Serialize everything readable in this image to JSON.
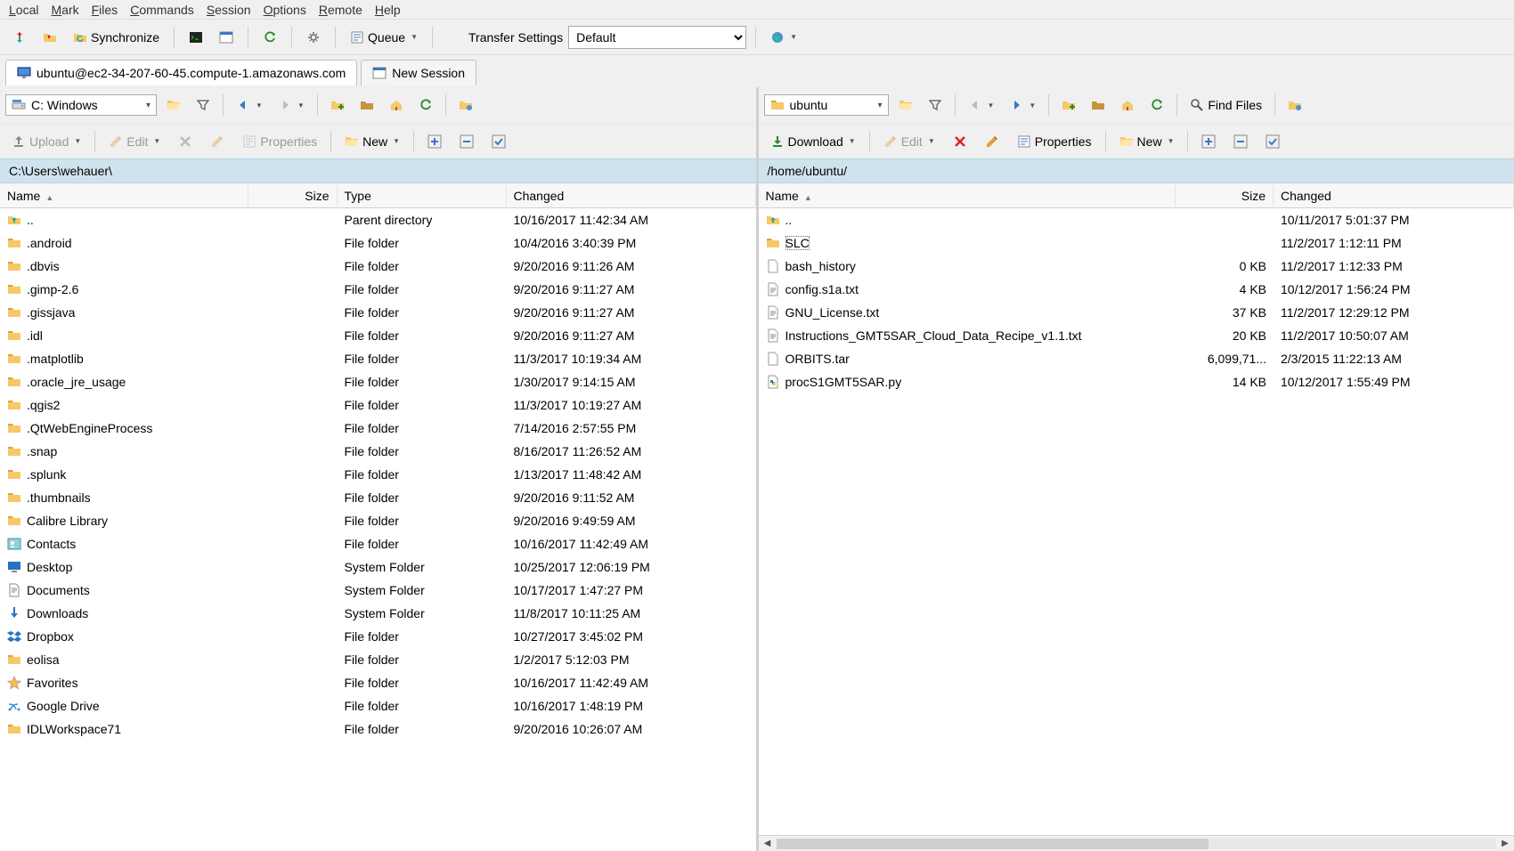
{
  "menu": [
    "Local",
    "Mark",
    "Files",
    "Commands",
    "Session",
    "Options",
    "Remote",
    "Help"
  ],
  "toolbar": {
    "sync_label": "Synchronize",
    "queue_label": "Queue",
    "transfer_label": "Transfer Settings",
    "transfer_value": "Default"
  },
  "session_tab": "ubuntu@ec2-34-207-60-45.compute-1.amazonaws.com",
  "new_session": "New Session",
  "left": {
    "drive": "C: Windows",
    "upload": "Upload",
    "edit": "Edit",
    "properties": "Properties",
    "new": "New",
    "path": "C:\\Users\\wehauer\\",
    "headers": {
      "name": "Name",
      "size": "Size",
      "type": "Type",
      "changed": "Changed"
    },
    "rows": [
      {
        "name": "..",
        "type": "Parent directory",
        "changed": "10/16/2017  11:42:34 AM",
        "icon": "up"
      },
      {
        "name": ".android",
        "type": "File folder",
        "changed": "10/4/2016  3:40:39 PM",
        "icon": "folder"
      },
      {
        "name": ".dbvis",
        "type": "File folder",
        "changed": "9/20/2016  9:11:26 AM",
        "icon": "folder"
      },
      {
        "name": ".gimp-2.6",
        "type": "File folder",
        "changed": "9/20/2016  9:11:27 AM",
        "icon": "folder"
      },
      {
        "name": ".gissjava",
        "type": "File folder",
        "changed": "9/20/2016  9:11:27 AM",
        "icon": "folder"
      },
      {
        "name": ".idl",
        "type": "File folder",
        "changed": "9/20/2016  9:11:27 AM",
        "icon": "folder"
      },
      {
        "name": ".matplotlib",
        "type": "File folder",
        "changed": "11/3/2017  10:19:34 AM",
        "icon": "folder"
      },
      {
        "name": ".oracle_jre_usage",
        "type": "File folder",
        "changed": "1/30/2017  9:14:15 AM",
        "icon": "folder"
      },
      {
        "name": ".qgis2",
        "type": "File folder",
        "changed": "11/3/2017  10:19:27 AM",
        "icon": "folder"
      },
      {
        "name": ".QtWebEngineProcess",
        "type": "File folder",
        "changed": "7/14/2016  2:57:55 PM",
        "icon": "folder"
      },
      {
        "name": ".snap",
        "type": "File folder",
        "changed": "8/16/2017  11:26:52 AM",
        "icon": "folder"
      },
      {
        "name": ".splunk",
        "type": "File folder",
        "changed": "1/13/2017  11:48:42 AM",
        "icon": "folder"
      },
      {
        "name": ".thumbnails",
        "type": "File folder",
        "changed": "9/20/2016  9:11:52 AM",
        "icon": "folder"
      },
      {
        "name": "Calibre Library",
        "type": "File folder",
        "changed": "9/20/2016  9:49:59 AM",
        "icon": "folder"
      },
      {
        "name": "Contacts",
        "type": "File folder",
        "changed": "10/16/2017  11:42:49 AM",
        "icon": "contacts"
      },
      {
        "name": "Desktop",
        "type": "System Folder",
        "changed": "10/25/2017  12:06:19 PM",
        "icon": "desktop"
      },
      {
        "name": "Documents",
        "type": "System Folder",
        "changed": "10/17/2017  1:47:27 PM",
        "icon": "documents"
      },
      {
        "name": "Downloads",
        "type": "System Folder",
        "changed": "11/8/2017  10:11:25 AM",
        "icon": "downloads"
      },
      {
        "name": "Dropbox",
        "type": "File folder",
        "changed": "10/27/2017  3:45:02 PM",
        "icon": "dropbox"
      },
      {
        "name": "eolisa",
        "type": "File folder",
        "changed": "1/2/2017  5:12:03 PM",
        "icon": "folder"
      },
      {
        "name": "Favorites",
        "type": "File folder",
        "changed": "10/16/2017  11:42:49 AM",
        "icon": "star"
      },
      {
        "name": "Google Drive",
        "type": "File folder",
        "changed": "10/16/2017  1:48:19 PM",
        "icon": "gdrive"
      },
      {
        "name": "IDLWorkspace71",
        "type": "File folder",
        "changed": "9/20/2016  10:26:07 AM",
        "icon": "folder"
      }
    ]
  },
  "right": {
    "drive": "ubuntu",
    "download": "Download",
    "edit": "Edit",
    "properties": "Properties",
    "new": "New",
    "find": "Find Files",
    "path": "/home/ubuntu/",
    "headers": {
      "name": "Name",
      "size": "Size",
      "changed": "Changed"
    },
    "rows": [
      {
        "name": "..",
        "size": "",
        "changed": "10/11/2017 5:01:37 PM",
        "icon": "up"
      },
      {
        "name": "SLC",
        "size": "",
        "changed": "11/2/2017 1:12:11 PM",
        "icon": "folder",
        "selected": true
      },
      {
        "name": "bash_history",
        "size": "0 KB",
        "changed": "11/2/2017 1:12:33 PM",
        "icon": "file"
      },
      {
        "name": "config.s1a.txt",
        "size": "4 KB",
        "changed": "10/12/2017 1:56:24 PM",
        "icon": "txt"
      },
      {
        "name": "GNU_License.txt",
        "size": "37 KB",
        "changed": "11/2/2017 12:29:12 PM",
        "icon": "txt"
      },
      {
        "name": "Instructions_GMT5SAR_Cloud_Data_Recipe_v1.1.txt",
        "size": "20 KB",
        "changed": "11/2/2017 10:50:07 AM",
        "icon": "txt"
      },
      {
        "name": "ORBITS.tar",
        "size": "6,099,71...",
        "changed": "2/3/2015 11:22:13 AM",
        "icon": "file"
      },
      {
        "name": "procS1GMT5SAR.py",
        "size": "14 KB",
        "changed": "10/12/2017 1:55:49 PM",
        "icon": "py"
      }
    ]
  }
}
